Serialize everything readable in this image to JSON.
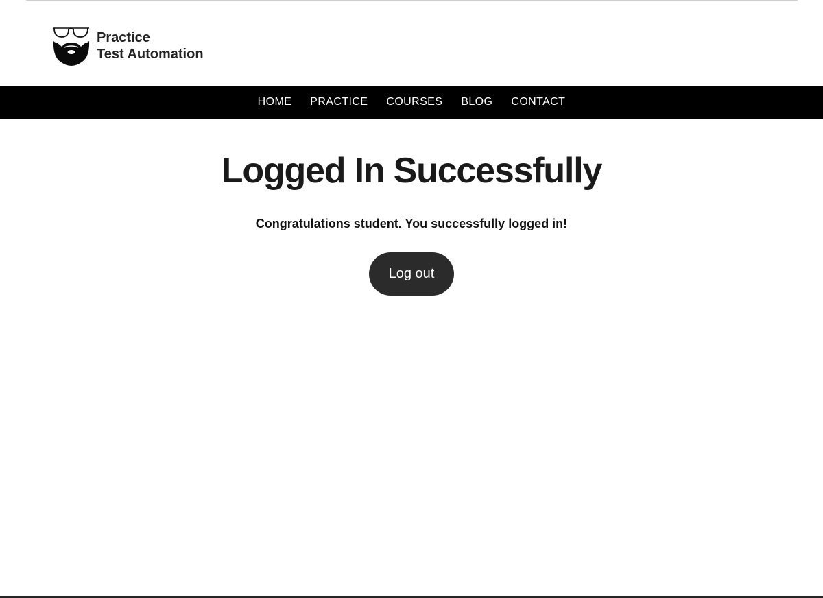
{
  "header": {
    "logo": {
      "line1": "Practice",
      "line2": "Test Automation"
    }
  },
  "nav": {
    "items": [
      {
        "label": "HOME"
      },
      {
        "label": "PRACTICE"
      },
      {
        "label": "COURSES"
      },
      {
        "label": "BLOG"
      },
      {
        "label": "CONTACT"
      }
    ]
  },
  "main": {
    "title": "Logged In Successfully",
    "message": "Congratulations student. You successfully logged in!",
    "logout_label": "Log out"
  },
  "colors": {
    "navbar_bg": "#000000",
    "button_bg": "#2b2b2b",
    "text": "#1a1a1a"
  }
}
